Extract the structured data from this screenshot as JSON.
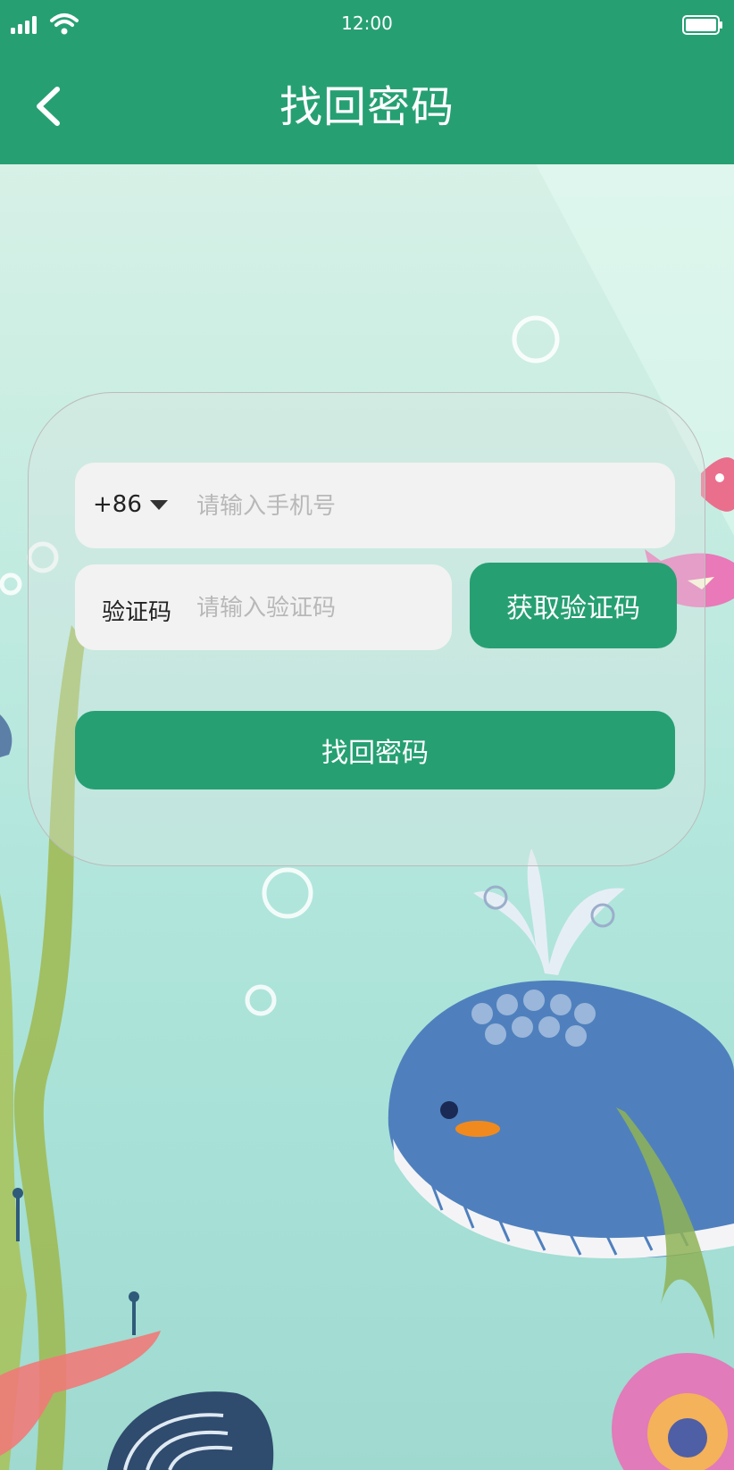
{
  "status_bar": {
    "time": "12:00"
  },
  "header": {
    "title": "找回密码",
    "back_icon": "chevron-left-icon"
  },
  "form": {
    "country_code": "+86",
    "phone_placeholder": "请输入手机号",
    "phone_value": "",
    "code_label": "验证码",
    "code_placeholder": "请输入验证码",
    "code_value": "",
    "get_code_label": "获取验证码",
    "submit_label": "找回密码"
  },
  "colors": {
    "primary": "#26a073",
    "field_bg": "#f2f2f2",
    "placeholder": "#b8b8b8"
  }
}
